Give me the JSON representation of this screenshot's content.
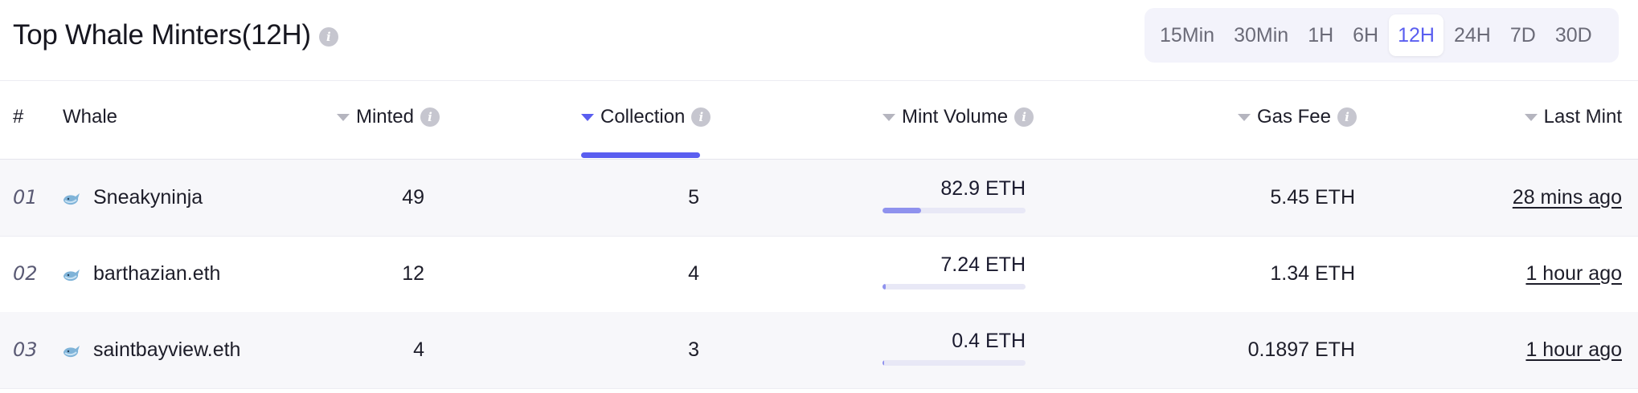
{
  "header": {
    "title": "Top Whale Minters(12H)",
    "info": "i",
    "time_filters": [
      "15Min",
      "30Min",
      "1H",
      "6H",
      "12H",
      "24H",
      "7D",
      "30D"
    ],
    "active_filter": "12H"
  },
  "columns": {
    "index": "#",
    "whale": "Whale",
    "minted": "Minted",
    "collection": "Collection",
    "mint_volume": "Mint Volume",
    "gas_fee": "Gas Fee",
    "last_mint": "Last Mint"
  },
  "sorted_by": "collection",
  "rows": [
    {
      "index": "01",
      "name": "Sneakyninja",
      "minted": "49",
      "collection": "5",
      "mint_volume": "82.9 ETH",
      "volume_share": 0.27,
      "gas_fee": "5.45 ETH",
      "last_mint": "28 mins ago"
    },
    {
      "index": "02",
      "name": "barthazian.eth",
      "minted": "12",
      "collection": "4",
      "mint_volume": "7.24 ETH",
      "volume_share": 0.02,
      "gas_fee": "1.34 ETH",
      "last_mint": "1 hour ago"
    },
    {
      "index": "03",
      "name": "saintbayview.eth",
      "minted": "4",
      "collection": "3",
      "mint_volume": "0.4 ETH",
      "volume_share": 0.01,
      "gas_fee": "0.1897 ETH",
      "last_mint": "1 hour ago"
    }
  ],
  "colors": {
    "accent": "#5a5ef0",
    "bar_fill": "#8f92ee",
    "bar_track": "#e8e8f6"
  },
  "icons": {
    "info": "info-icon",
    "sort": "sort-triangle-icon",
    "whale": "whale-icon"
  }
}
